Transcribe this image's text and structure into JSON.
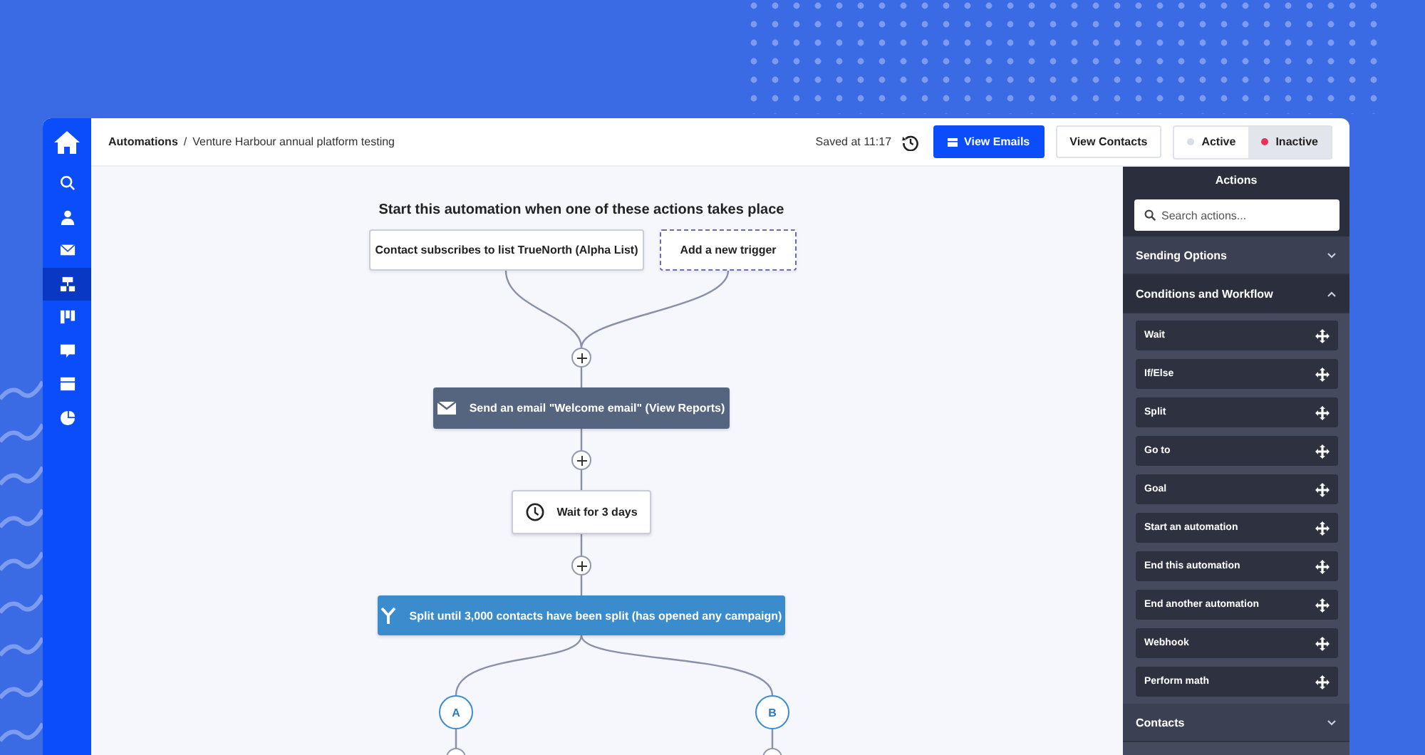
{
  "sidebar": {
    "items": [
      {
        "selected": false
      },
      {
        "selected": false
      },
      {
        "selected": false
      },
      {
        "selected": true
      },
      {
        "selected": false
      },
      {
        "selected": false
      },
      {
        "selected": false
      },
      {
        "selected": false
      }
    ]
  },
  "breadcrumb": {
    "parent": "Automations",
    "separator": "/",
    "current": "Venture Harbour annual platform testing"
  },
  "saved_text": "Saved at 11:17",
  "buttons": [
    {
      "label": "View Emails",
      "kind": "primary"
    },
    {
      "label": "View Contacts",
      "kind": "secondary"
    }
  ],
  "status_toggle": [
    {
      "label": "Active",
      "selected": false,
      "color": "#d9dce6"
    },
    {
      "label": "Inactive",
      "selected": true,
      "color": "#e8305a"
    }
  ],
  "canvas": {
    "heading": "Start this automation when one of these actions takes place",
    "triggers": [
      {
        "label": "Contact subscribes to list TrueNorth (Alpha List)",
        "kind": "trigger"
      },
      {
        "label": "Add a new trigger",
        "kind": "add"
      }
    ],
    "steps": [
      {
        "kind": "email",
        "label": "Send an email \"Welcome email\" (View Reports)"
      },
      {
        "kind": "wait",
        "label": "Wait for 3 days"
      },
      {
        "kind": "split",
        "label": "Split until 3,000 contacts have been split (has opened any campaign)"
      }
    ],
    "branches": [
      "A",
      "B"
    ]
  },
  "actions_panel": {
    "title": "Actions",
    "search_placeholder": "Search actions...",
    "sections": [
      {
        "title": "Sending Options",
        "expanded": false
      },
      {
        "title": "Conditions and Workflow",
        "expanded": true,
        "items": [
          "Wait",
          "If/Else",
          "Split",
          "Go to",
          "Goal",
          "Start an automation",
          "End this automation",
          "End another automation",
          "Webhook",
          "Perform math"
        ]
      },
      {
        "title": "Contacts",
        "expanded": false
      }
    ]
  }
}
